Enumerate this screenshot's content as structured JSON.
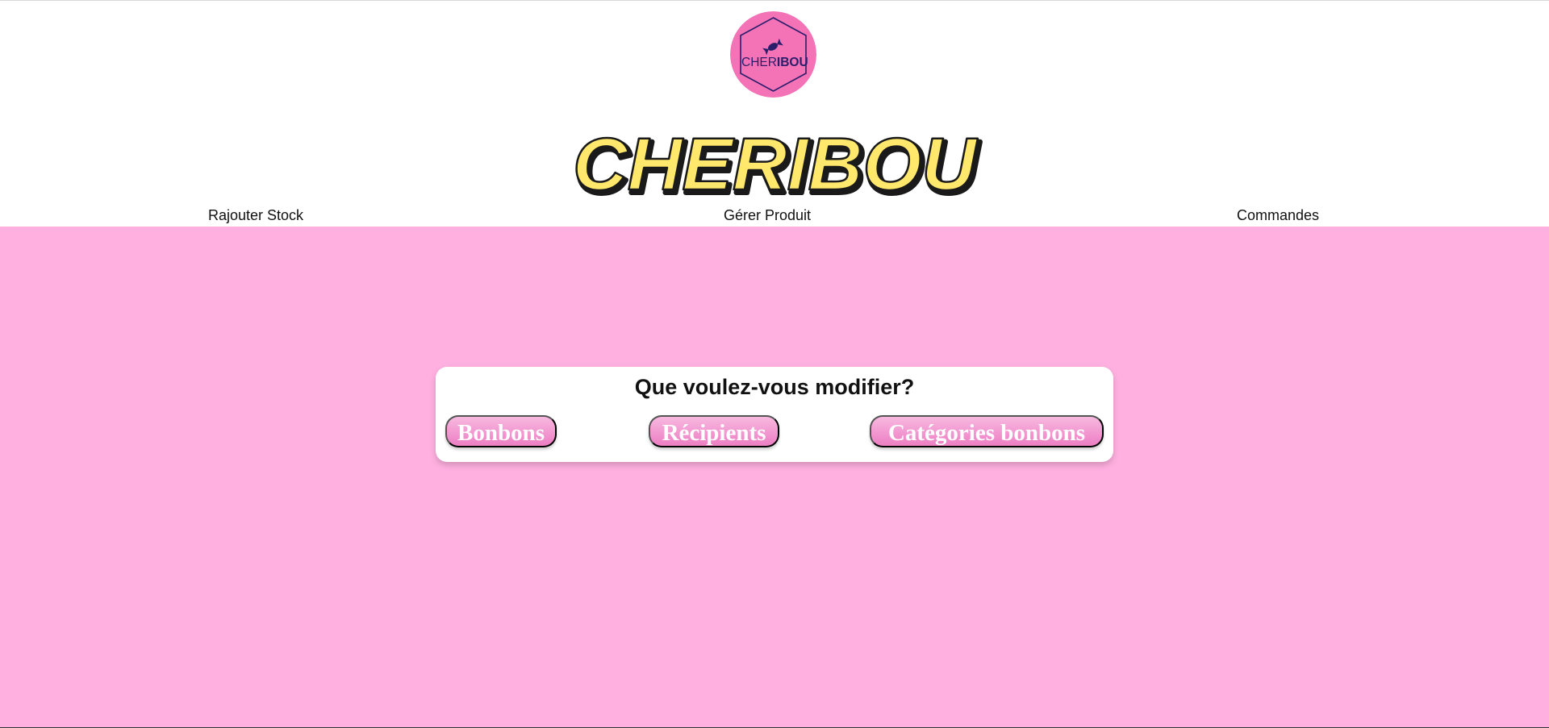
{
  "brand": {
    "logo_text_light": "CHER",
    "logo_text_bold": "IBOU",
    "title": "CHERIBOU"
  },
  "nav": {
    "items": [
      {
        "label": "Rajouter Stock"
      },
      {
        "label": "Gérer Produit"
      },
      {
        "label": "Commandes"
      }
    ]
  },
  "main": {
    "question": "Que voulez-vous modifier?",
    "options": [
      {
        "label": "Bonbons"
      },
      {
        "label": "Récipients"
      },
      {
        "label": "Catégories bonbons"
      }
    ]
  },
  "colors": {
    "background": "#ffb0e0",
    "logo_circle": "#f472b6",
    "logo_navy": "#2a1e6b",
    "title_fill": "#ffe86b",
    "button": "#f08ccb"
  },
  "icons": {
    "logo": "candy-icon"
  }
}
